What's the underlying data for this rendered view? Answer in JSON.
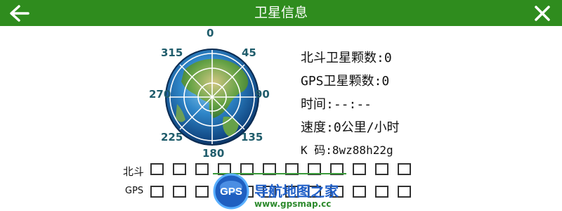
{
  "header": {
    "title": "卫星信息",
    "back_icon": "back-arrow-icon",
    "close_icon": "close-icon",
    "bg_color": "#2f8c1e"
  },
  "compass": {
    "directions": {
      "n": "0",
      "ne": "45",
      "e": "90",
      "se": "135",
      "s": "180",
      "sw": "225",
      "w": "270",
      "nw": "315"
    }
  },
  "info": {
    "beidou": "北斗卫星颗数:0",
    "gps": "GPS卫星颗数:0",
    "time": "时间:--:--",
    "speed": "速度:0公里/小时",
    "code": "K 码:8wz88h22g"
  },
  "signal": {
    "beidou_label": "北斗",
    "gps_label": "GPS",
    "beidou_bars": [
      0,
      0,
      0,
      0,
      0,
      0,
      0,
      0,
      0,
      0,
      0,
      0
    ],
    "gps_bars": [
      0,
      0,
      0,
      0,
      0,
      0,
      0,
      0,
      0,
      0,
      0,
      0
    ]
  },
  "watermark": {
    "badge": "GPS",
    "text": "导航地图之家",
    "url": "www.gpsmap.cc"
  }
}
